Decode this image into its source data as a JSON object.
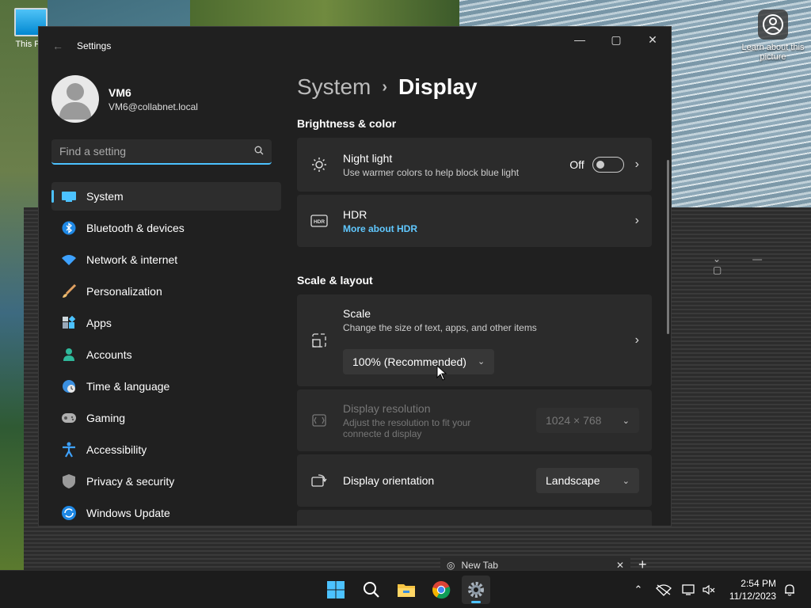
{
  "desktop": {
    "icon_label": "This PC",
    "learn_label": "Learn about this picture"
  },
  "window": {
    "title": "Settings"
  },
  "profile": {
    "name": "VM6",
    "email": "VM6@collabnet.local"
  },
  "search": {
    "placeholder": "Find a setting"
  },
  "nav": [
    {
      "label": "System",
      "icon": "system-icon",
      "active": true
    },
    {
      "label": "Bluetooth & devices",
      "icon": "bluetooth-icon"
    },
    {
      "label": "Network & internet",
      "icon": "wifi-icon"
    },
    {
      "label": "Personalization",
      "icon": "brush-icon"
    },
    {
      "label": "Apps",
      "icon": "apps-icon"
    },
    {
      "label": "Accounts",
      "icon": "accounts-icon"
    },
    {
      "label": "Time & language",
      "icon": "globe-clock-icon"
    },
    {
      "label": "Gaming",
      "icon": "gamepad-icon"
    },
    {
      "label": "Accessibility",
      "icon": "accessibility-icon"
    },
    {
      "label": "Privacy & security",
      "icon": "shield-icon"
    },
    {
      "label": "Windows Update",
      "icon": "update-icon"
    }
  ],
  "breadcrumb": {
    "parent": "System",
    "current": "Display"
  },
  "sections": {
    "brightness": "Brightness & color",
    "scale_layout": "Scale & layout"
  },
  "night_light": {
    "title": "Night light",
    "subtitle": "Use warmer colors to help block blue light",
    "state_label": "Off"
  },
  "hdr": {
    "title": "HDR",
    "link": "More about HDR",
    "icon_text": "HDR"
  },
  "scale": {
    "title": "Scale",
    "subtitle": "Change the size of text, apps, and other items",
    "value": "100% (Recommended)"
  },
  "resolution": {
    "title": "Display resolution",
    "subtitle": "Adjust the resolution to fit your connecte d display",
    "value": "1024 × 768"
  },
  "orientation": {
    "title": "Display orientation",
    "value": "Landscape"
  },
  "browser_tab": {
    "label": "New Tab"
  },
  "clock": {
    "time": "2:54 PM",
    "date": "11/12/2023"
  },
  "colors": {
    "accent": "#4cc2ff",
    "window_bg": "#202020",
    "card_bg": "#2b2b2b"
  }
}
